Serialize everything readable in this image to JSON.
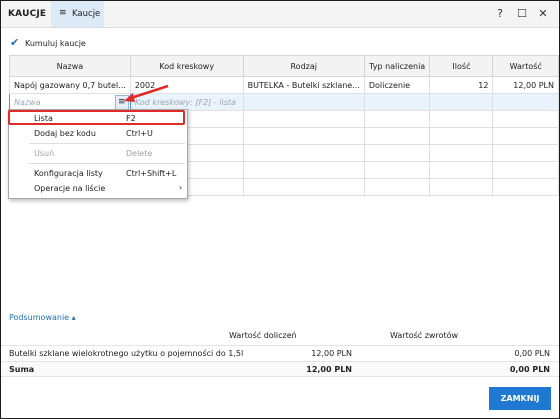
{
  "app": {
    "title": "KAUCJE"
  },
  "tab": {
    "icon": "hamburger-icon",
    "label": "Kaucje"
  },
  "window_controls": {
    "help": "?",
    "maximize": "☐",
    "close": "✕"
  },
  "kumuluj": {
    "checked": true,
    "label": "Kumuluj kaucje"
  },
  "grid": {
    "columns": [
      "Nazwa",
      "Kod kreskowy",
      "Rodzaj",
      "Typ naliczenia",
      "Ilość",
      "Wartość"
    ],
    "rows": [
      {
        "nazwa": "Napój gazowany 0,7 butel...",
        "kod": "2002",
        "rodzaj": "BUTELKA - Butelki szklane...",
        "typ": "Doliczenie",
        "ilosc": "12",
        "wartosc": "12,00 PLN"
      }
    ],
    "new_row": {
      "nazwa_placeholder": "Nazwa",
      "kod_placeholder": "Kod kreskowy: [F2] - lista"
    }
  },
  "context_menu": {
    "items": [
      {
        "label": "Lista",
        "shortcut": "F2"
      },
      {
        "label": "Dodaj bez kodu",
        "shortcut": "Ctrl+U"
      },
      {
        "label": "Usuń",
        "shortcut": "Delete"
      },
      {
        "label": "Konfiguracja listy",
        "shortcut": "Ctrl+Shift+L"
      },
      {
        "label": "Operacje na liście",
        "shortcut": "›"
      }
    ]
  },
  "summary": {
    "toggle_label": "Podsumowanie ▴",
    "headers": {
      "doliczen": "Wartość doliczeń",
      "zwrotow": "Wartość zwrotów"
    },
    "rows": [
      {
        "label": "Butelki szklane wielokrotnego użytku o pojemności do 1,5l",
        "doliczen": "12,00 PLN",
        "zwrotow": "0,00 PLN"
      },
      {
        "label": "Suma",
        "doliczen": "12,00 PLN",
        "zwrotow": "0,00 PLN"
      }
    ]
  },
  "buttons": {
    "close": "ZAMKNIJ"
  },
  "colors": {
    "accent": "#1f78d1",
    "highlight": "#e02a2a",
    "tab_bg": "#dce9f6"
  }
}
